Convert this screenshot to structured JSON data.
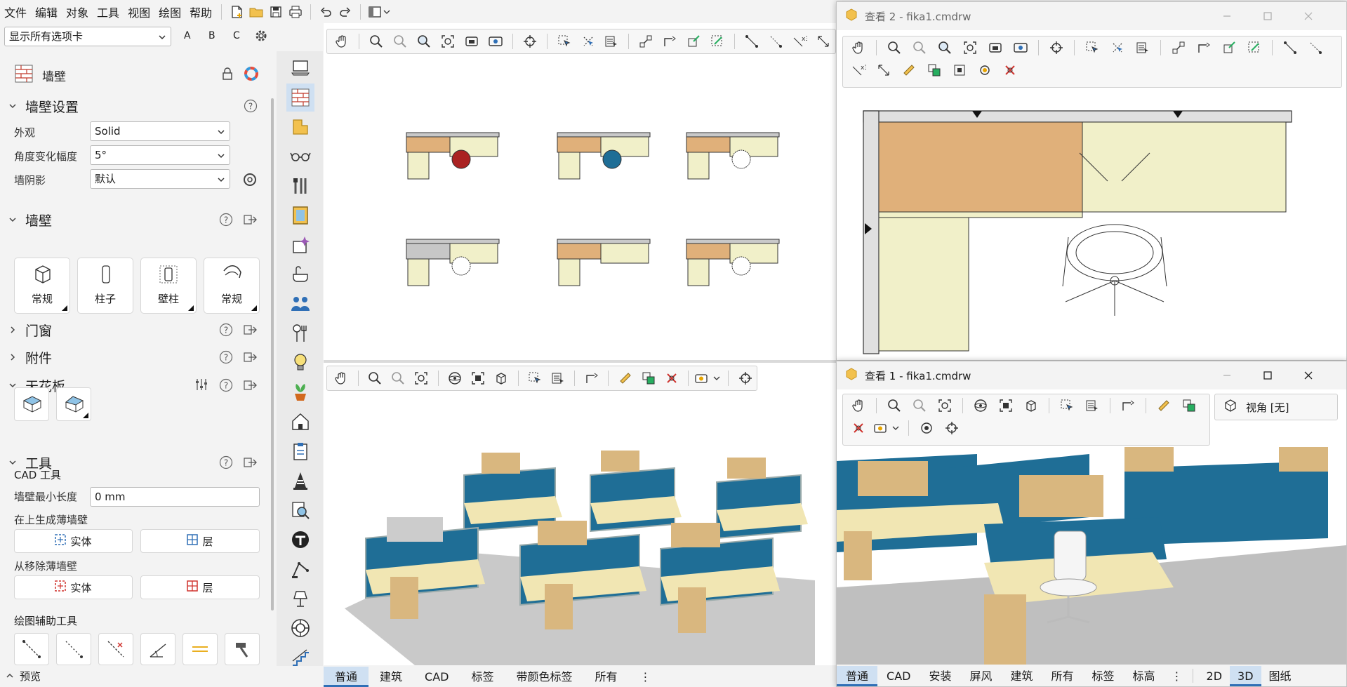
{
  "menu": {
    "items": [
      "文件",
      "编辑",
      "对象",
      "工具",
      "视图",
      "绘图",
      "帮助"
    ]
  },
  "left_panel": {
    "tab_selector": "显示所有选项卡",
    "tab_shortcuts": [
      "A",
      "B",
      "C"
    ],
    "title": "墙壁",
    "wall_settings": {
      "header": "墙壁设置",
      "rows": [
        {
          "label": "外观",
          "value": "Solid"
        },
        {
          "label": "角度变化幅度",
          "value": "5°"
        },
        {
          "label": "墙阴影",
          "value": "默认"
        }
      ]
    },
    "walls_section": {
      "header": "墙壁",
      "buttons": [
        "常规",
        "柱子",
        "壁柱",
        "常规"
      ]
    },
    "sections": [
      "门窗",
      "附件",
      "天花板"
    ],
    "tools": {
      "header": "工具",
      "cad_tools": "CAD 工具",
      "min_length_label": "墙壁最小长度",
      "min_length_value": "0 mm",
      "generate_label": "在上生成薄墙壁",
      "remove_label": "从移除薄墙壁",
      "solid": "实体",
      "layer": "层",
      "drawing_aids": "绘图辅助工具"
    },
    "preview": "预览"
  },
  "view_tabs": [
    "普通",
    "建筑",
    "CAD",
    "标签",
    "带颜色标签",
    "所有"
  ],
  "window2": {
    "title": "查看 2 - fika1.cmdrw"
  },
  "window1": {
    "title": "查看 1 - fika1.cmdrw",
    "view_angle": "视角 [无]",
    "tabs": [
      "普通",
      "CAD",
      "安装",
      "屏风",
      "建筑",
      "所有",
      "标签",
      "标高"
    ],
    "mode_tabs": [
      "2D",
      "3D",
      "图纸"
    ]
  },
  "colors": {
    "accent": "#2f6fb6",
    "panel_blue": "#1f6e96",
    "desk": "#f1e6b3",
    "cabinet": "#d9b77f"
  }
}
